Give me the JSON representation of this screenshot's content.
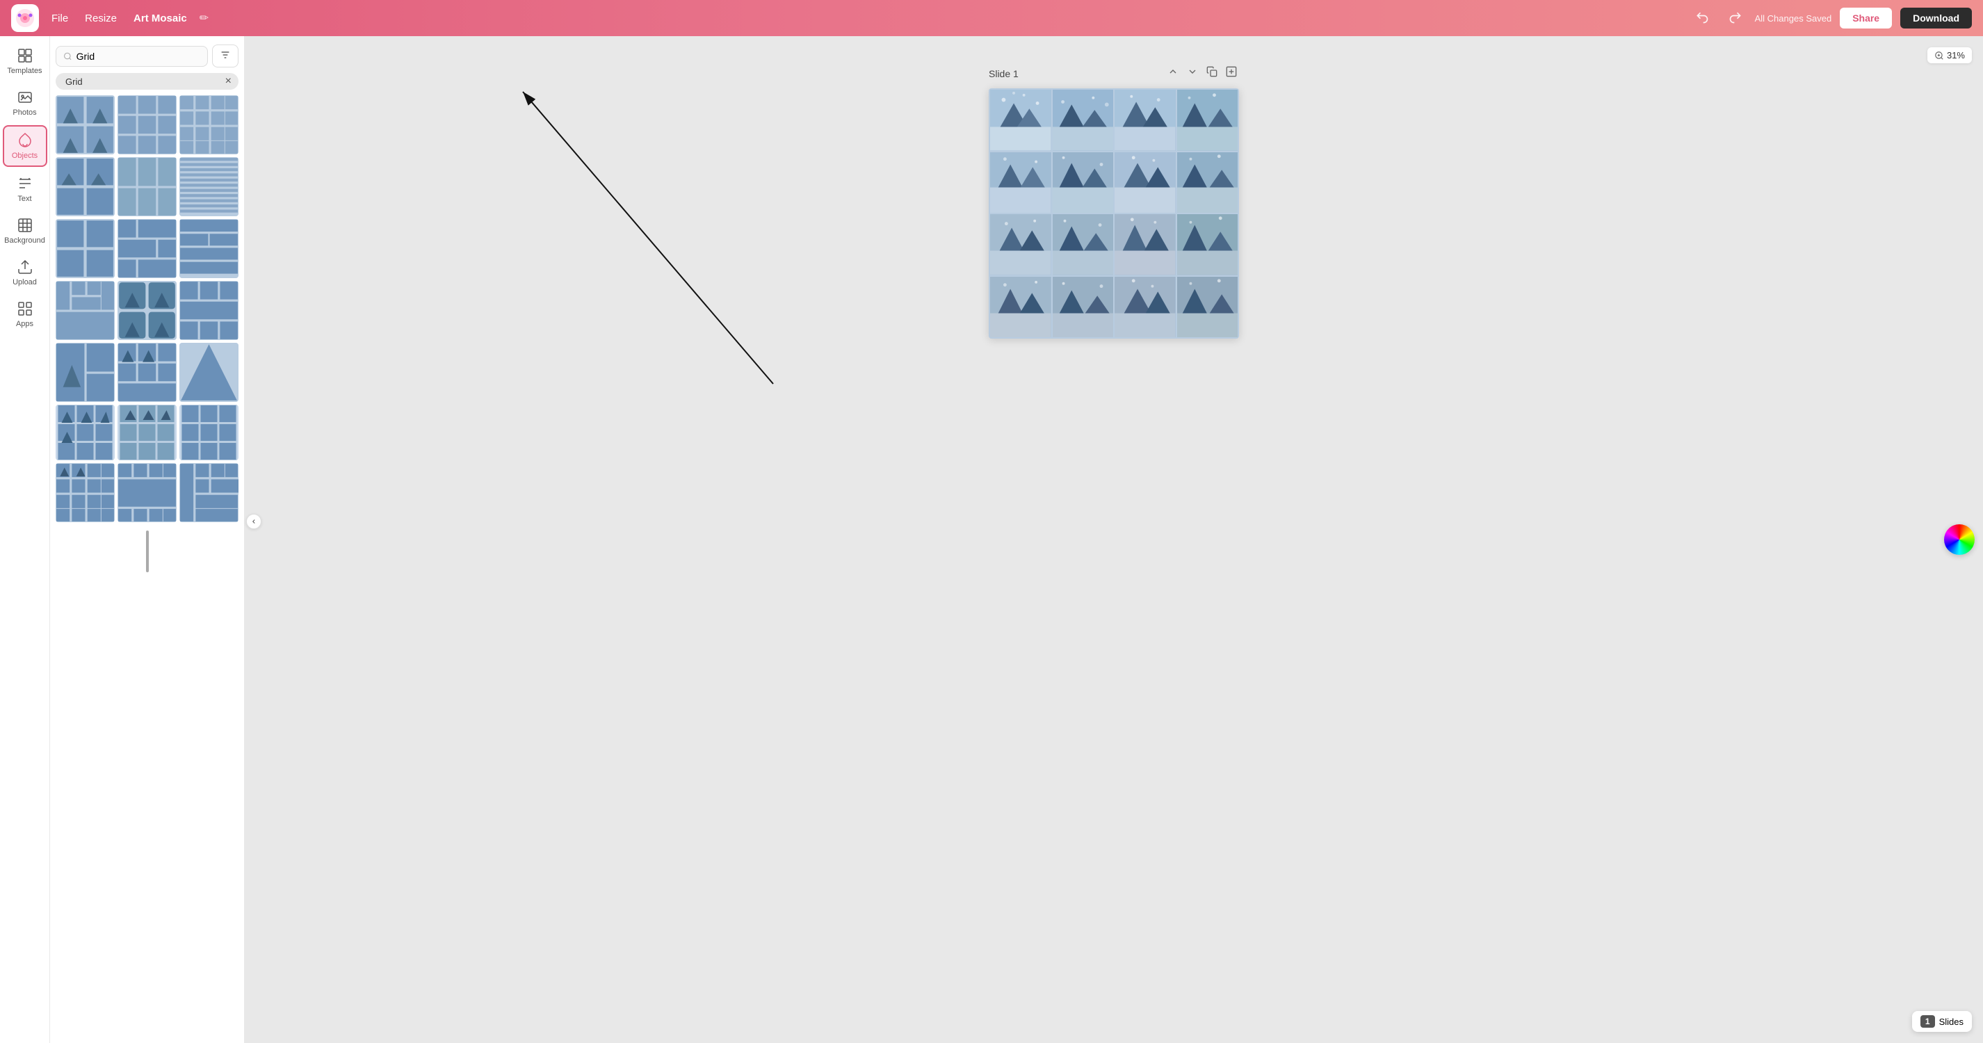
{
  "topbar": {
    "file_label": "File",
    "resize_label": "Resize",
    "project_title": "Art Mosaic",
    "edit_icon": "✏",
    "undo_icon": "↩",
    "redo_icon": "↪",
    "saved_text": "All Changes Saved",
    "share_label": "Share",
    "download_label": "Download"
  },
  "sidebar": {
    "items": [
      {
        "id": "templates",
        "label": "Templates",
        "icon": "templates"
      },
      {
        "id": "photos",
        "label": "Photos",
        "icon": "photos"
      },
      {
        "id": "objects",
        "label": "Objects",
        "icon": "objects",
        "active": true
      },
      {
        "id": "text",
        "label": "Text",
        "icon": "text"
      },
      {
        "id": "background",
        "label": "Background",
        "icon": "background"
      },
      {
        "id": "upload",
        "label": "Upload",
        "icon": "upload"
      },
      {
        "id": "apps",
        "label": "Apps",
        "icon": "apps"
      }
    ]
  },
  "search": {
    "placeholder": "Grid",
    "value": "Grid",
    "filter_icon": "filter",
    "category_tag": "Grid",
    "close_icon": "×"
  },
  "canvas": {
    "zoom_icon": "🔍",
    "zoom_level": "31%",
    "slide_label": "Slide 1",
    "up_icon": "▲",
    "down_icon": "▼",
    "copy_icon": "⧉",
    "add_icon": "⊞"
  },
  "slides_panel": {
    "count": "1",
    "label": "Slides"
  }
}
